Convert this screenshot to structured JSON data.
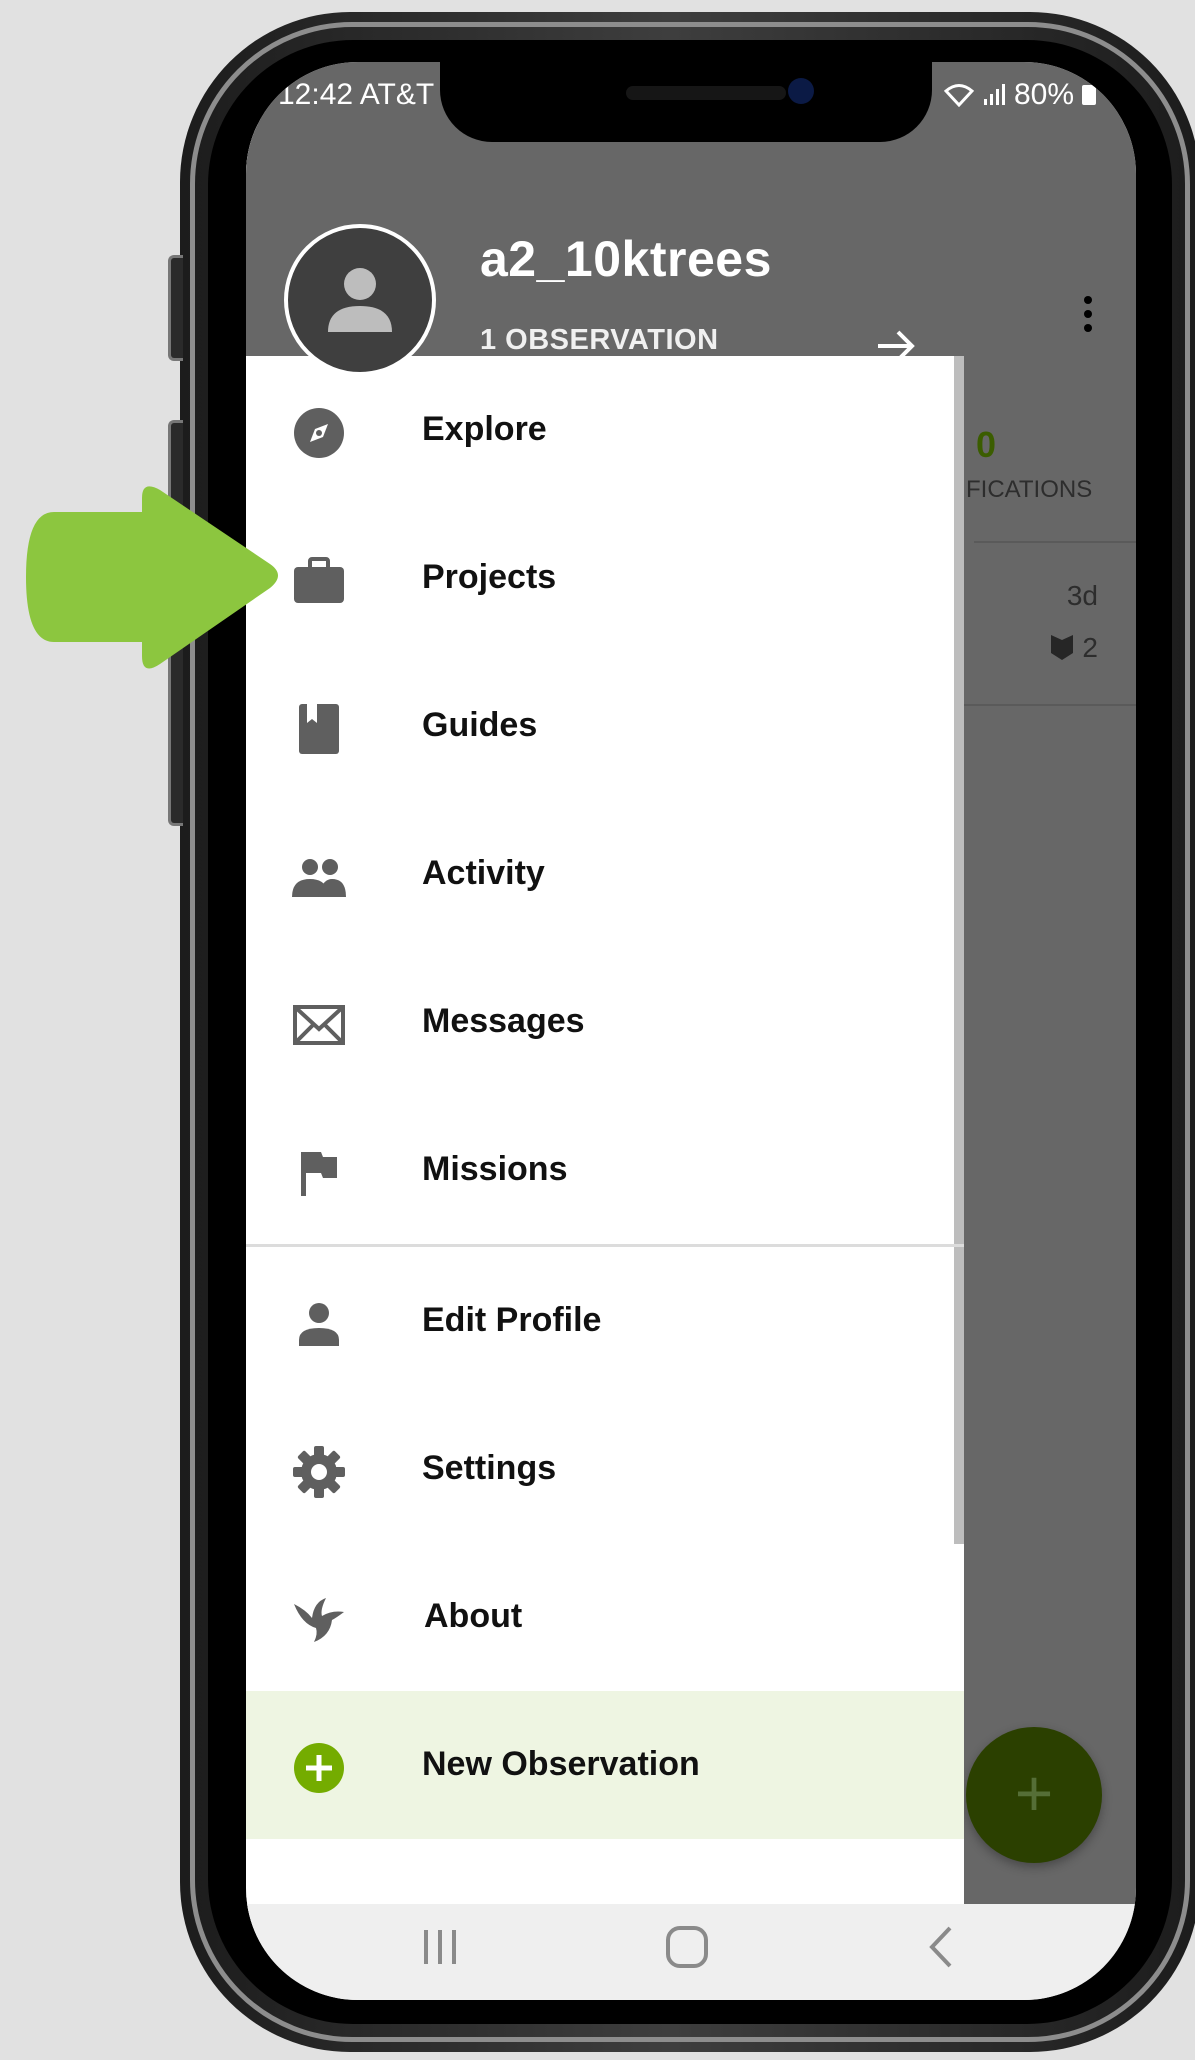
{
  "status_bar": {
    "time": "12:42 AT&T",
    "battery": "80%"
  },
  "drawer": {
    "username": "a2_10ktrees",
    "observation_count": "1 OBSERVATION",
    "items": [
      {
        "label": "Explore",
        "icon": "compass-icon"
      },
      {
        "label": "Projects",
        "icon": "briefcase-icon"
      },
      {
        "label": "Guides",
        "icon": "book-icon"
      },
      {
        "label": "Activity",
        "icon": "people-icon"
      },
      {
        "label": "Messages",
        "icon": "envelope-icon"
      },
      {
        "label": "Missions",
        "icon": "flag-icon"
      },
      {
        "label": "Edit Profile",
        "icon": "person-icon"
      },
      {
        "label": "Settings",
        "icon": "gear-icon"
      },
      {
        "label": "About",
        "icon": "bird-icon"
      },
      {
        "label": "New Observation",
        "icon": "plus-circle-icon"
      }
    ]
  },
  "background": {
    "identifications_count": "0",
    "identifications_label": "FICATIONS",
    "age": "3d",
    "ids": "2",
    "fab_label": "+"
  },
  "nav_bar": {
    "recents_icon": "recents-icon",
    "home_icon": "home-icon",
    "back_icon": "back-icon"
  },
  "colors": {
    "header_gray": "#676767",
    "brand_green": "#74ac00",
    "new_observation_bg": "#eef5e2",
    "callout_arrow": "#8cc63f",
    "fab_dim": "#2b4000"
  }
}
